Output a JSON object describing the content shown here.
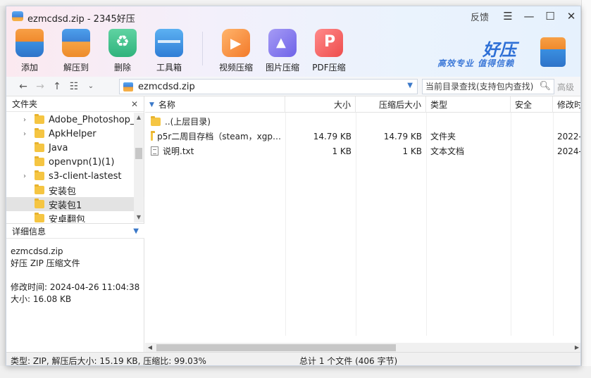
{
  "window": {
    "title": "ezmcdsd.zip - 2345好压",
    "feedback": "反馈",
    "menu_glyph": "☰",
    "min_glyph": "—",
    "max_glyph": "☐",
    "close_glyph": "✕"
  },
  "toolbar": {
    "items": [
      {
        "label": "添加",
        "icon": "archive-add-icon"
      },
      {
        "label": "解压到",
        "icon": "archive-extract-icon"
      },
      {
        "label": "删除",
        "icon": "recycle-bin-icon"
      },
      {
        "label": "工具箱",
        "icon": "toolbox-icon"
      },
      {
        "label": "视频压缩",
        "icon": "video-compress-icon"
      },
      {
        "label": "图片压缩",
        "icon": "image-compress-icon"
      },
      {
        "label": "PDF压缩",
        "icon": "pdf-compress-icon"
      }
    ]
  },
  "brand": {
    "name": "好压",
    "slogan": "高效专业 值得信赖"
  },
  "address": {
    "path": "ezmcdsd.zip",
    "search_placeholder": "当前目录查找(支持包内查找)",
    "advanced": "高级"
  },
  "left_panel": {
    "folders_header": "文件夹",
    "close_glyph": "✕",
    "tree": [
      {
        "label": "Adobe_Photoshop_",
        "expandable": true
      },
      {
        "label": "ApkHelper",
        "expandable": true
      },
      {
        "label": "Java",
        "expandable": false
      },
      {
        "label": "openvpn(1)(1)",
        "expandable": false
      },
      {
        "label": "s3-client-lastest",
        "expandable": true
      },
      {
        "label": "安装包",
        "expandable": false
      },
      {
        "label": "安装包1",
        "expandable": false,
        "selected": true
      },
      {
        "label": "安卓翻包",
        "expandable": false
      }
    ],
    "details_header": "详细信息",
    "details": {
      "filename": "ezmcdsd.zip",
      "filetype": "好压 ZIP 压缩文件",
      "modified": "修改时间: 2024-04-26 11:04:38",
      "size": "大小: 16.08 KB"
    }
  },
  "file_list": {
    "columns": {
      "name": "名称",
      "size": "大小",
      "compressed": "压缩后大小",
      "type": "类型",
      "security": "安全",
      "modified": "修改时"
    },
    "rows": [
      {
        "name": "..(上层目录)",
        "size": "",
        "compressed": "",
        "type": "",
        "security": "",
        "modified": "",
        "kind": "folder"
      },
      {
        "name": "p5r二周目存档（steam，xgp…",
        "size": "14.79 KB",
        "compressed": "14.79 KB",
        "type": "文件夹",
        "security": "",
        "modified": "2022-",
        "kind": "folder"
      },
      {
        "name": "说明.txt",
        "size": "1 KB",
        "compressed": "1 KB",
        "type": "文本文档",
        "security": "",
        "modified": "2024-",
        "kind": "text"
      }
    ]
  },
  "status": {
    "left": "类型: ZIP, 解压后大小: 15.19 KB, 压缩比: 99.03%",
    "right": "总计 1 个文件 (406 字节)"
  }
}
